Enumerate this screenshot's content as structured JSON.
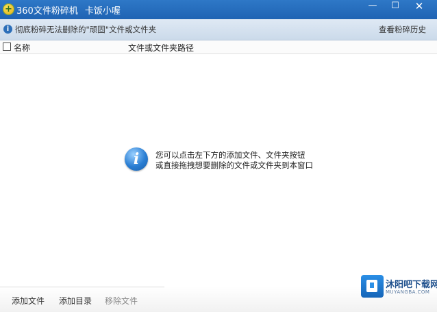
{
  "window": {
    "title": "360文件粉碎机",
    "subtitle": "卡饭小喔",
    "controls": {
      "minimize": "—",
      "maximize": "☐",
      "close": "✕"
    }
  },
  "infobar": {
    "text": "彻底粉碎无法删除的\"顽固\"文件或文件夹",
    "history_link": "查看粉碎历史"
  },
  "table": {
    "columns": {
      "name": "名称",
      "path": "文件或文件夹路径"
    },
    "rows": []
  },
  "empty_hint": {
    "line1": "您可以点击左下方的添加文件、文件夹按钮",
    "line2": "或直接拖拽想要删除的文件或文件夹到本窗口"
  },
  "toolbar": {
    "add_file": "添加文件",
    "add_dir": "添加目录",
    "remove_file": "移除文件"
  },
  "watermark": {
    "text": "沐阳吧下载网",
    "url": "MUYANGBA.COM"
  },
  "colors": {
    "titlebar": "#1f63b3",
    "infobar": "#d6e3f1",
    "accent": "#2a7ed3"
  },
  "icons": {
    "title_logo": "shredder-logo-icon",
    "info": "info-icon",
    "hint": "info-large-icon",
    "watermark": "cube-icon"
  }
}
